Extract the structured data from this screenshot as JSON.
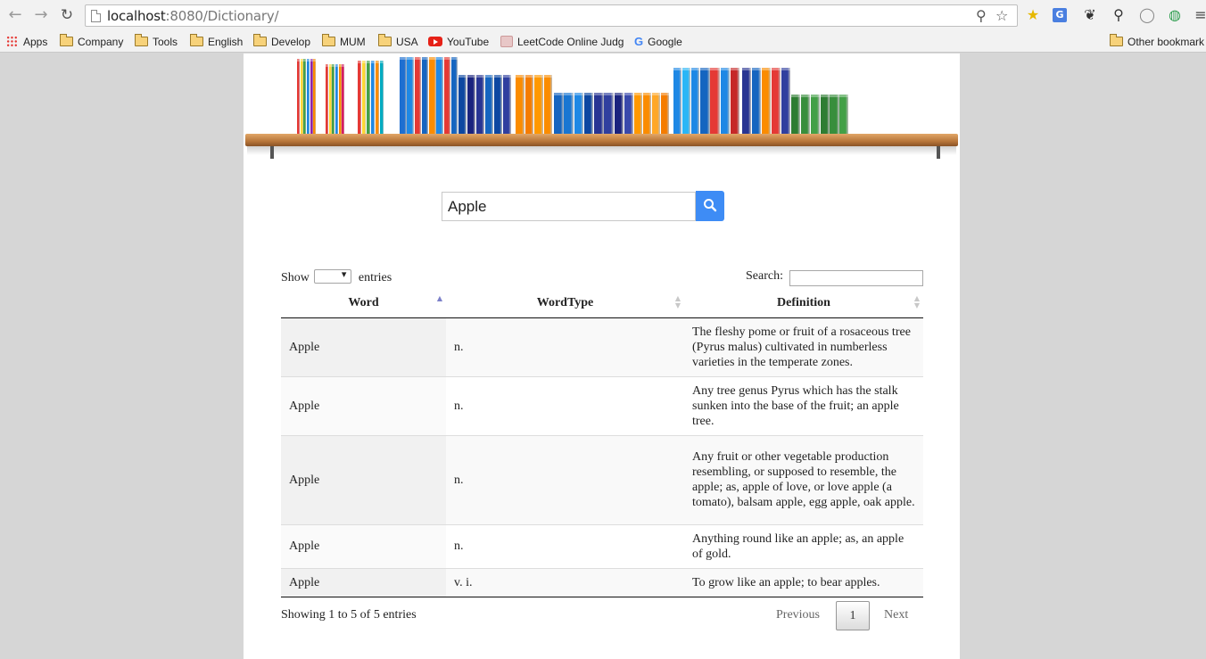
{
  "browser": {
    "url_host": "localhost",
    "url_path": ":8080/Dictionary/",
    "bookmarks": [
      {
        "label": "Apps"
      },
      {
        "label": "Company"
      },
      {
        "label": "Tools"
      },
      {
        "label": "English"
      },
      {
        "label": "Develop"
      },
      {
        "label": "MUM"
      },
      {
        "label": "USA"
      },
      {
        "label": "YouTube"
      },
      {
        "label": "LeetCode Online Judg"
      },
      {
        "label": "Google"
      }
    ],
    "other_bookmarks": "Other bookmark"
  },
  "search": {
    "value": "Apple"
  },
  "table_controls": {
    "show_label": "Show",
    "entries_label": "entries",
    "search_label": "Search:"
  },
  "table": {
    "columns": [
      "Word",
      "WordType",
      "Definition"
    ],
    "rows": [
      {
        "word": "Apple",
        "type": "n.",
        "definition": "The fleshy pome or fruit of a rosaceous tree (Pyrus malus) cultivated in numberless varieties in the temperate zones."
      },
      {
        "word": "Apple",
        "type": "n.",
        "definition": "Any tree genus Pyrus which has the stalk sunken into the base of the fruit; an apple tree."
      },
      {
        "word": "Apple",
        "type": "n.",
        "definition": "Any fruit or other vegetable production resembling, or supposed to resemble, the apple; as, apple of love, or love apple (a tomato), balsam apple, egg apple, oak apple."
      },
      {
        "word": "Apple",
        "type": "n.",
        "definition": "Anything round like an apple; as, an apple of gold."
      },
      {
        "word": "Apple",
        "type": "v. i.",
        "definition": "To grow like an apple; to bear apples."
      }
    ]
  },
  "footer": {
    "info": "Showing 1 to 5 of 5 entries",
    "previous": "Previous",
    "page": "1",
    "next": "Next"
  },
  "colors": {
    "search_button": "#3e8cf5",
    "sort_active": "#7c80c9"
  }
}
